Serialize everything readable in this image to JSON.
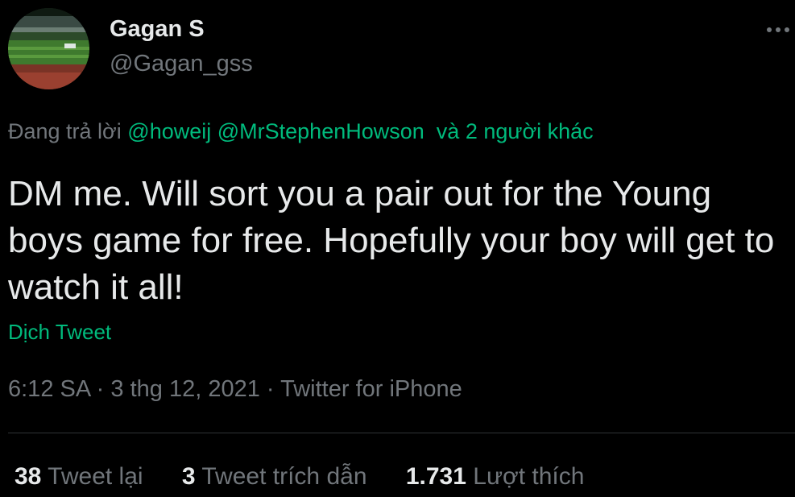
{
  "user": {
    "display_name": "Gagan S",
    "username": "@Gagan_gss"
  },
  "more_icon": "more-dots-icon",
  "reply": {
    "prefix": "Đang trả lời",
    "mention_1": "@howeij",
    "mention_2": "@MrStephenHowson",
    "others": "và 2 người khác"
  },
  "tweet": {
    "text": "DM me. Will sort you a pair out for the Young boys game for free. Hopefully your boy will get to watch it all!",
    "translate_label": "Dịch Tweet"
  },
  "meta": {
    "time": "6:12 SA",
    "date": "3 thg 12, 2021",
    "source": "Twitter for iPhone",
    "separator": "·"
  },
  "stats": {
    "retweets_count": "38",
    "retweets_label": "Tweet lại",
    "quotes_count": "3",
    "quotes_label": "Tweet trích dẫn",
    "likes_count": "1.731",
    "likes_label": "Lượt thích"
  },
  "colors": {
    "background": "#000000",
    "primary_text": "#e7e9ea",
    "secondary_text": "#71767b",
    "link_green": "#00ba7c",
    "divider": "#2f3336"
  }
}
